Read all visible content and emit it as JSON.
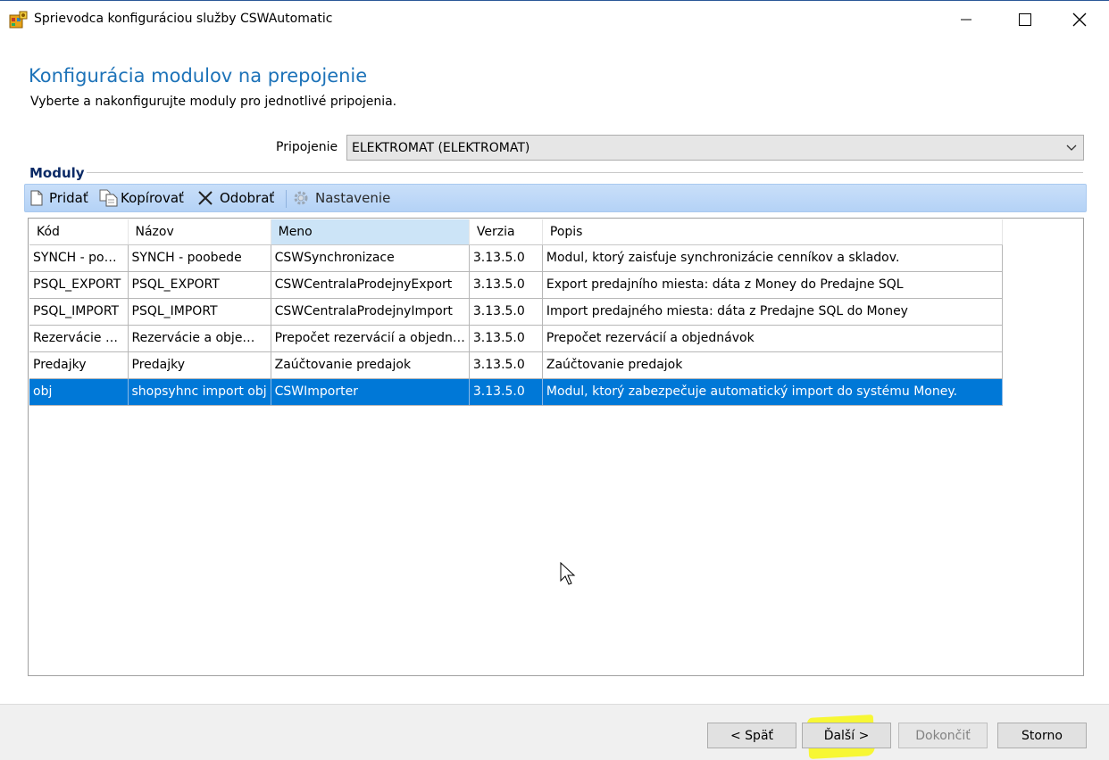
{
  "window": {
    "title": "Sprievodca konfiguráciou služby CSWAutomatic",
    "icon": "app-config-icon"
  },
  "header": {
    "title": "Konfigurácia modulov na prepojenie",
    "subtitle": "Vyberte a nakonfigurujte moduly pro jednotlivé pripojenia."
  },
  "connection": {
    "label": "Pripojenie",
    "selected": "ELEKTROMAT (ELEKTROMAT)"
  },
  "modules": {
    "group_label": "Moduly",
    "toolbar": {
      "add": "Pridať",
      "copy": "Kopírovať",
      "remove": "Odobrať",
      "settings": "Nastavenie"
    },
    "columns": [
      "Kód",
      "Názov",
      "Meno",
      "Verzia",
      "Popis"
    ],
    "rows": [
      [
        "SYNCH - po…",
        "SYNCH - poobede",
        "CSWSynchronizace",
        "3.13.5.0",
        "Modul, ktorý zaisťuje synchronizácie cenníkov a skladov."
      ],
      [
        "PSQL_EXPORT",
        "PSQL_EXPORT",
        "CSWCentralaProdejnyExport",
        "3.13.5.0",
        "Export predajního miesta: dáta z Money do Predajne SQL"
      ],
      [
        "PSQL_IMPORT",
        "PSQL_IMPORT",
        "CSWCentralaProdejnyImport",
        "3.13.5.0",
        "Import predajného miesta: dáta z Predajne SQL do Money"
      ],
      [
        "Rezervácie …",
        "Rezervácie a obje…",
        "Prepočet rezervácií a objedn…",
        "3.13.5.0",
        "Prepočet rezervácií a objednávok"
      ],
      [
        "Predajky",
        "Predajky",
        "Zaúčtovanie predajok",
        "3.13.5.0",
        "Zaúčtovanie predajok"
      ],
      [
        "obj",
        "shopsyhnc import obj",
        "CSWImporter",
        "3.13.5.0",
        "Modul, ktorý zabezpečuje automatický import do systému Money."
      ]
    ],
    "selected_row": 5,
    "sorted_column": 2
  },
  "buttons": {
    "back": "< Späť",
    "next": "Ďalší >",
    "finish": "Dokončiť",
    "cancel": "Storno"
  },
  "colors": {
    "accent_title": "#1c72b8",
    "selection": "#0078d7",
    "toolbar": "#c9dff9",
    "highlight": "#f7f71f"
  }
}
